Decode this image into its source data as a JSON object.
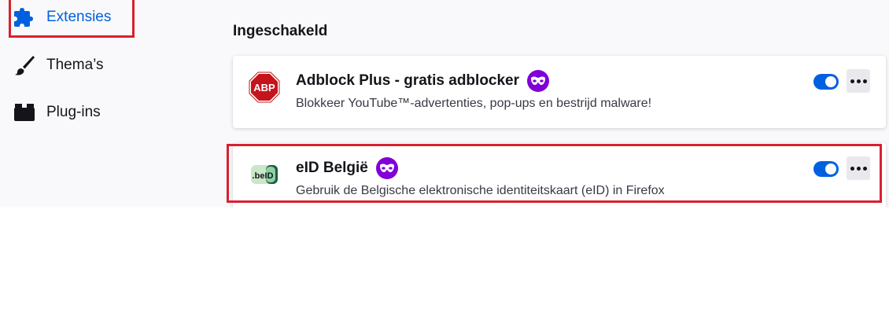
{
  "colors": {
    "accent": "#0061e0",
    "highlight": "#d7212f",
    "private_badge": "#8000d7",
    "background": "#f9f9fb"
  },
  "sidebar": {
    "items": [
      {
        "label": "Extensies",
        "icon": "puzzle-icon",
        "active": true
      },
      {
        "label": "Thema’s",
        "icon": "brush-icon",
        "active": false
      },
      {
        "label": "Plug-ins",
        "icon": "plugin-icon",
        "active": false
      }
    ]
  },
  "main": {
    "section_heading": "Ingeschakeld",
    "addons": [
      {
        "name": "Adblock Plus - gratis adblocker",
        "description": "Blokkeer YouTube™-advertenties, pop-ups en bestrijd malware!",
        "icon": "abp-icon",
        "icon_text": "ABP",
        "private_badge": "private-browsing-icon",
        "enabled": true,
        "more_icon": "more-options-icon"
      },
      {
        "name": "eID België",
        "description": "Gebruik de Belgische elektronische identiteitskaart (eID) in Firefox",
        "icon": "eid-icon",
        "icon_text": ".beID",
        "private_badge": "private-browsing-icon",
        "enabled": true,
        "more_icon": "more-options-icon"
      }
    ]
  }
}
